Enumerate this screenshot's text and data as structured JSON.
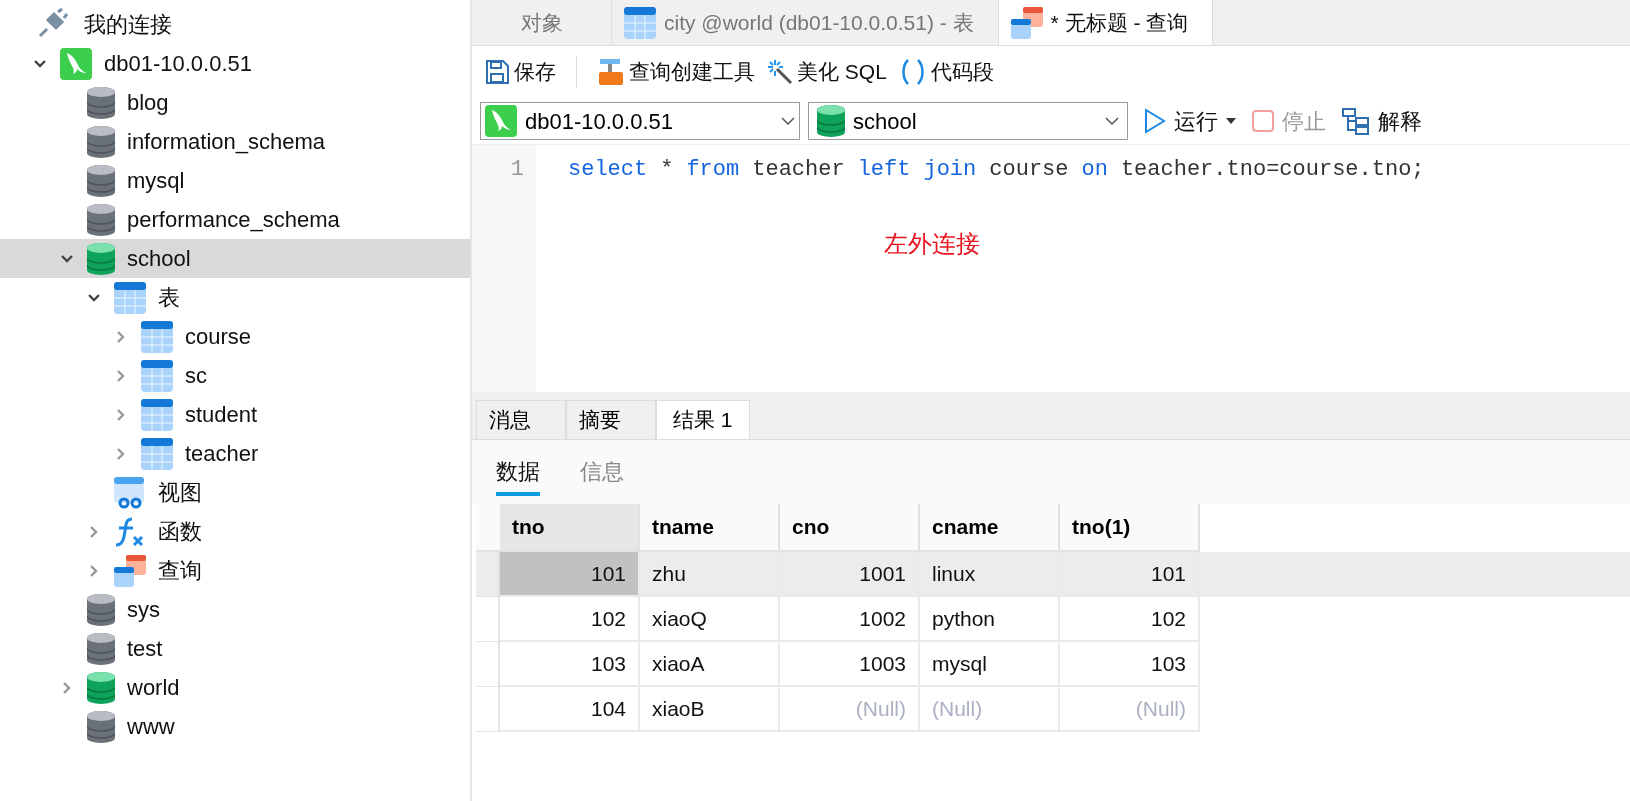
{
  "sidebar": {
    "title": "我的连接",
    "tree": [
      {
        "kind": "connection",
        "label": "db01-10.0.0.51",
        "expanded": true,
        "selected": false,
        "children": [
          {
            "kind": "database",
            "label": "blog",
            "opened": false,
            "selected": false
          },
          {
            "kind": "database",
            "label": "information_schema",
            "opened": false,
            "selected": false
          },
          {
            "kind": "database",
            "label": "mysql",
            "opened": false,
            "selected": false
          },
          {
            "kind": "database",
            "label": "performance_schema",
            "opened": false,
            "selected": false
          },
          {
            "kind": "database",
            "label": "school",
            "opened": true,
            "expanded": true,
            "selected": true,
            "children": [
              {
                "kind": "tables",
                "label": "表",
                "expanded": true,
                "selected": false,
                "children": [
                  {
                    "kind": "table",
                    "label": "course",
                    "expanded": false,
                    "selected": false
                  },
                  {
                    "kind": "table",
                    "label": "sc",
                    "expanded": false,
                    "selected": false
                  },
                  {
                    "kind": "table",
                    "label": "student",
                    "expanded": false,
                    "selected": false
                  },
                  {
                    "kind": "table",
                    "label": "teacher",
                    "expanded": false,
                    "selected": false
                  }
                ]
              },
              {
                "kind": "views",
                "label": "视图",
                "selected": false
              },
              {
                "kind": "functions",
                "label": "函数",
                "expanded": false,
                "selected": false
              },
              {
                "kind": "queries",
                "label": "查询",
                "expanded": false,
                "selected": false
              }
            ]
          },
          {
            "kind": "database",
            "label": "sys",
            "opened": false,
            "selected": false
          },
          {
            "kind": "database",
            "label": "test",
            "opened": false,
            "selected": false
          },
          {
            "kind": "database",
            "label": "world",
            "opened": true,
            "expanded": false,
            "selected": false
          },
          {
            "kind": "database",
            "label": "www",
            "opened": false,
            "selected": false
          }
        ]
      }
    ]
  },
  "tabs": [
    {
      "kind": "objects",
      "label": "对象",
      "selected": false
    },
    {
      "kind": "table",
      "label": "city @world (db01-10.0.0.51) - 表",
      "selected": false
    },
    {
      "kind": "query",
      "label": "* 无标题 - 查询",
      "selected": true
    }
  ],
  "toolbar": [
    {
      "kind": "save",
      "label": "保存"
    },
    {
      "kind": "builder",
      "label": "查询创建工具"
    },
    {
      "kind": "beautify",
      "label": "美化 SQL"
    },
    {
      "kind": "snippet",
      "label": "代码段"
    }
  ],
  "connection_select": {
    "value": "db01-10.0.0.51"
  },
  "database_select": {
    "value": "school"
  },
  "actions": [
    {
      "kind": "run",
      "label": "运行",
      "disabled": false
    },
    {
      "kind": "stop",
      "label": "停止",
      "disabled": true
    },
    {
      "kind": "explain",
      "label": "解释",
      "disabled": false
    }
  ],
  "editor": {
    "line_number": "1",
    "tokens": [
      {
        "text": "select",
        "keyword": true
      },
      {
        "text": "*",
        "keyword": false
      },
      {
        "text": "from",
        "keyword": true
      },
      {
        "text": "teacher",
        "keyword": false
      },
      {
        "text": "left",
        "keyword": true
      },
      {
        "text": "join",
        "keyword": true
      },
      {
        "text": "course",
        "keyword": false
      },
      {
        "text": "on",
        "keyword": true
      },
      {
        "text": "teacher.tno=course.tno;",
        "keyword": false
      }
    ],
    "annotation": "左外连接"
  },
  "result_tabs": [
    {
      "label": "消息",
      "selected": false
    },
    {
      "label": "摘要",
      "selected": false
    },
    {
      "label": "结果 1",
      "selected": true
    }
  ],
  "sub_tabs": [
    {
      "label": "数据",
      "selected": true
    },
    {
      "label": "信息",
      "selected": false
    }
  ],
  "table": {
    "columns": [
      {
        "label": "tno",
        "numeric": true
      },
      {
        "label": "tname",
        "numeric": false
      },
      {
        "label": "cno",
        "numeric": true
      },
      {
        "label": "cname",
        "numeric": false
      },
      {
        "label": "tno(1)",
        "numeric": true
      }
    ],
    "rows": [
      {
        "selected": true,
        "cells": [
          {
            "text": "101",
            "null": false
          },
          {
            "text": "zhu",
            "null": false
          },
          {
            "text": "1001",
            "null": false
          },
          {
            "text": "linux",
            "null": false
          },
          {
            "text": "101",
            "null": false
          }
        ]
      },
      {
        "selected": false,
        "cells": [
          {
            "text": "102",
            "null": false
          },
          {
            "text": "xiaoQ",
            "null": false
          },
          {
            "text": "1002",
            "null": false
          },
          {
            "text": "python",
            "null": false
          },
          {
            "text": "102",
            "null": false
          }
        ]
      },
      {
        "selected": false,
        "cells": [
          {
            "text": "103",
            "null": false
          },
          {
            "text": "xiaoA",
            "null": false
          },
          {
            "text": "1003",
            "null": false
          },
          {
            "text": "mysql",
            "null": false
          },
          {
            "text": "103",
            "null": false
          }
        ]
      },
      {
        "selected": false,
        "cells": [
          {
            "text": "104",
            "null": false
          },
          {
            "text": "xiaoB",
            "null": false
          },
          {
            "text": "(Null)",
            "null": true
          },
          {
            "text": "(Null)",
            "null": true
          },
          {
            "text": "(Null)",
            "null": true
          }
        ]
      }
    ]
  }
}
